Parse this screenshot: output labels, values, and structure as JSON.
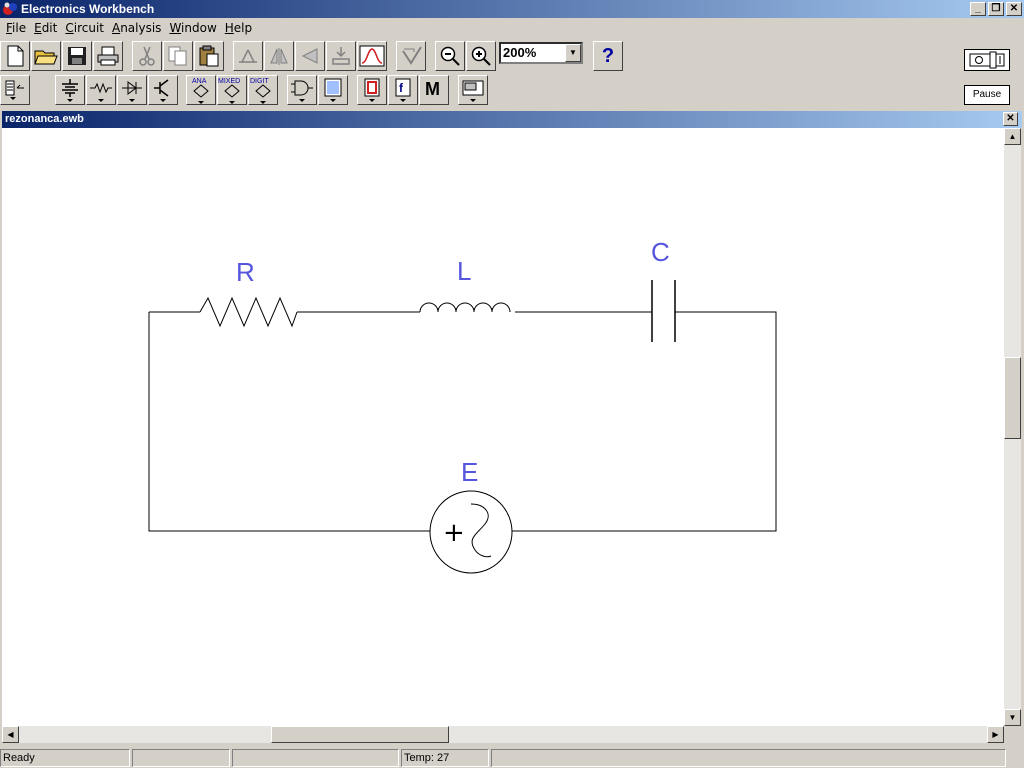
{
  "window": {
    "title": "Electronics Workbench"
  },
  "menu": {
    "items": [
      {
        "label": "File",
        "u": "F",
        "rest": "ile"
      },
      {
        "label": "Edit",
        "u": "E",
        "rest": "dit"
      },
      {
        "label": "Circuit",
        "u": "C",
        "rest": "ircuit"
      },
      {
        "label": "Analysis",
        "u": "A",
        "rest": "nalysis"
      },
      {
        "label": "Window",
        "u": "W",
        "rest": "indow"
      },
      {
        "label": "Help",
        "u": "H",
        "rest": "elp"
      }
    ]
  },
  "toolbar": {
    "zoom_value": "200%",
    "help_label": "?",
    "pause_label": "Pause",
    "parts_labels": {
      "ana": "ANA",
      "mixed": "MIXED",
      "digit": "DIGIT",
      "misc": "M"
    }
  },
  "document": {
    "title": "rezonanca.ewb"
  },
  "circuit": {
    "components": [
      {
        "label": "R",
        "type": "resistor"
      },
      {
        "label": "L",
        "type": "inductor"
      },
      {
        "label": "C",
        "type": "capacitor"
      },
      {
        "label": "E",
        "type": "ac-source"
      }
    ],
    "source_polarity": "+",
    "color": "#5555dd"
  },
  "status": {
    "ready": "Ready",
    "temp_label": "Temp:",
    "temp_value": "27"
  }
}
